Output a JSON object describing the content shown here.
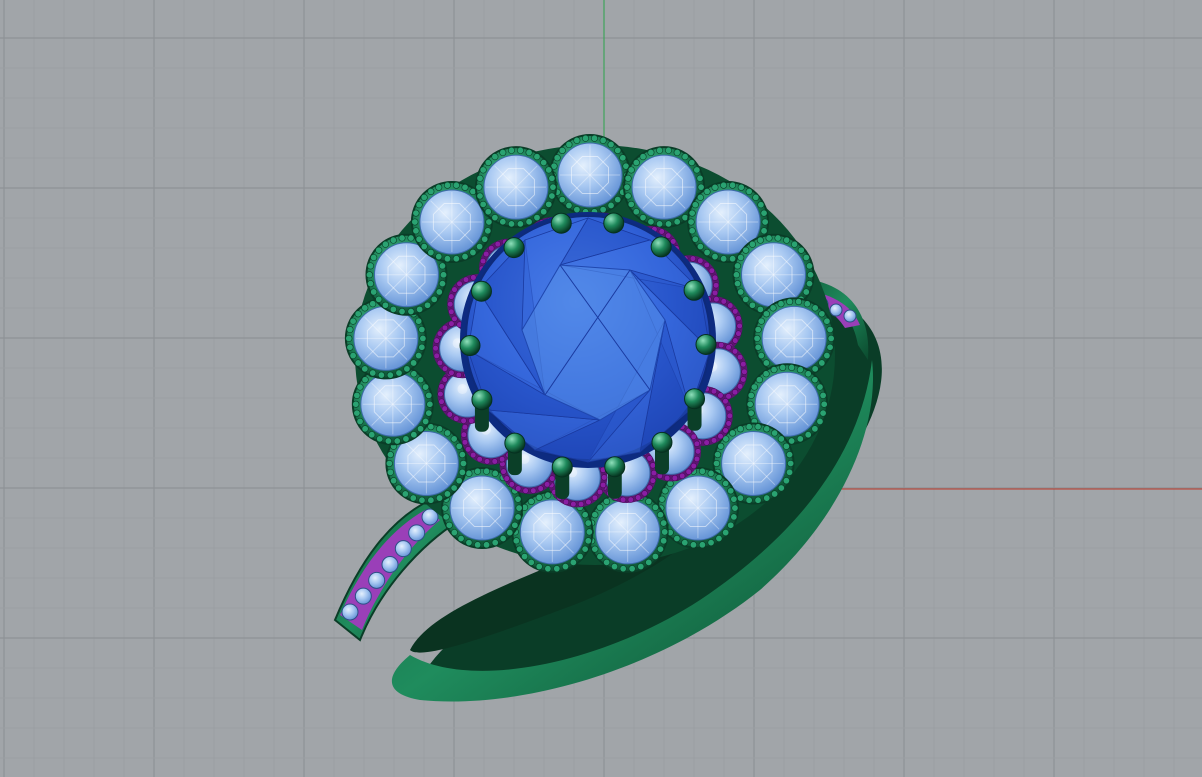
{
  "viewport": {
    "background": "#a1a5a9",
    "grid_minor_color": "#9a9ea2",
    "grid_major_color": "#8e9296",
    "axis_x_color": "#c0392b",
    "axis_y_color": "#2fa84f"
  },
  "model": {
    "metal_color": "#1e8a5c",
    "metal_dark": "#0a3d27",
    "bead_color": "#8a1ea3",
    "center_stone_color": "#2d55cf",
    "center_stone_light": "#4f86e6",
    "side_stone_color": "#9cc0ee",
    "side_stone_light": "#d2e6fb",
    "outer_halo_stones": 17,
    "inner_halo_stones": 16,
    "prongs": 14
  }
}
